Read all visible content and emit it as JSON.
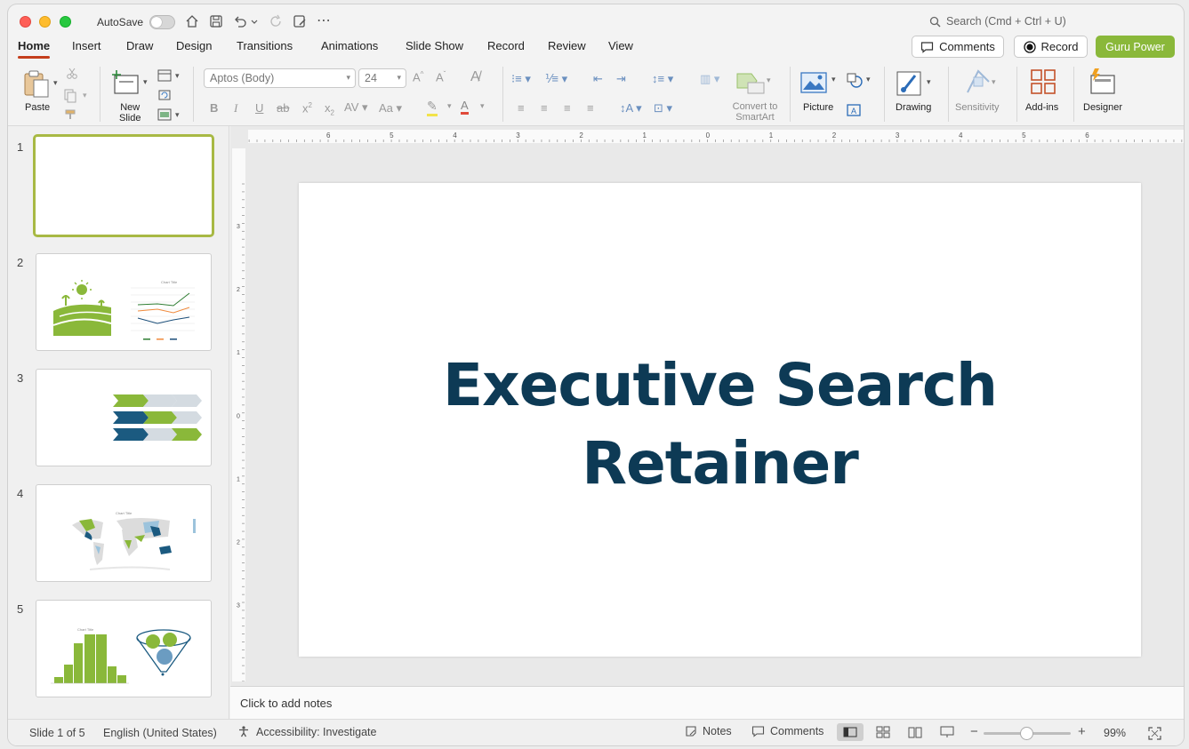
{
  "titlebar": {
    "autosave_label": "AutoSave",
    "search_placeholder": "Search (Cmd + Ctrl + U)"
  },
  "tabs": [
    "Home",
    "Insert",
    "Draw",
    "Design",
    "Transitions",
    "Animations",
    "Slide Show",
    "Record",
    "Review",
    "View"
  ],
  "header_buttons": {
    "comments": "Comments",
    "record": "Record",
    "guru": "Guru Power"
  },
  "ribbon": {
    "paste": "Paste",
    "new_slide_line1": "New",
    "new_slide_line2": "Slide",
    "font_name": "Aptos (Body)",
    "font_size": "24",
    "convert_line1": "Convert to",
    "convert_line2": "SmartArt",
    "picture": "Picture",
    "drawing": "Drawing",
    "sensitivity": "Sensitivity",
    "addins": "Add-ins",
    "designer": "Designer"
  },
  "slides": [
    {
      "num": "1"
    },
    {
      "num": "2"
    },
    {
      "num": "3"
    },
    {
      "num": "4"
    },
    {
      "num": "5"
    }
  ],
  "ruler": {
    "h_ticks": [
      "6",
      "5",
      "4",
      "3",
      "2",
      "1",
      "0",
      "1",
      "2",
      "3",
      "4",
      "5",
      "6"
    ],
    "v_ticks": [
      "3",
      "2",
      "1",
      "0",
      "1",
      "2",
      "3"
    ]
  },
  "slide": {
    "title_line1": "Executive Search",
    "title_line2": "Retainer"
  },
  "notes_placeholder": "Click to add notes",
  "status": {
    "slide_count": "Slide 1 of 5",
    "language": "English (United States)",
    "accessibility": "Accessibility: Investigate",
    "notes": "Notes",
    "comments": "Comments",
    "zoom": "99%"
  },
  "colors": {
    "accent_green": "#8ab83a",
    "title_navy": "#0d3a55",
    "tab_underline": "#c43e1c"
  }
}
